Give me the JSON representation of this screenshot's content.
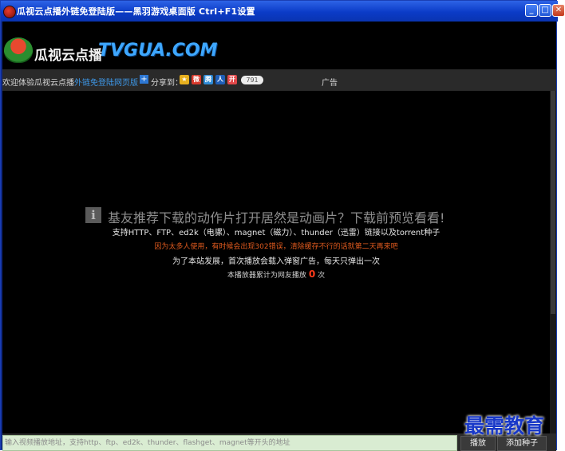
{
  "window": {
    "title": "瓜视云点播外链免登陆版——黑羽游戏桌面版 Ctrl+F1设置",
    "buttons": {
      "minimize": "_",
      "maximize": "□",
      "close": "✕"
    }
  },
  "logo": {
    "cn": "瓜视云点播",
    "en": "TVGUA.COM"
  },
  "nav": {
    "welcome": "欢迎体验瓜视云点播",
    "welcome_link": "外链免登陆网页版",
    "share_label": "分享到：",
    "share_count": "791",
    "ad_label": "广告"
  },
  "player": {
    "headline": "基友推荐下载的动作片打开居然是动画片？下载前预览看看!",
    "support": "支持HTTP、FTP、ed2k（电骡）、magnet（磁力）、thunder（迅雷）链接以及torrent种子",
    "warning": "因为太多人使用，有时候会出现302错误，清除缓存不行的话就第二天再来吧",
    "ad_notice": "为了本站发展，首次播放会载入弹窗广告，每天只弹出一次",
    "count_prefix": "本播放器累计为网友播放",
    "count_value": "0",
    "count_suffix": "次"
  },
  "bottom": {
    "url_placeholder": "输入视频播放地址，支持http、ftp、ed2k、thunder、flashget、magnet等开头的地址",
    "play_button": "播放",
    "add_seed_button": "添加种子"
  },
  "watermark": "最需教育",
  "icons": {
    "app": "watermelon-icon",
    "share": [
      "qzone-icon",
      "weibo-icon",
      "tencent-weibo-icon",
      "renren-icon",
      "kaixin-icon"
    ],
    "info": "info-icon"
  },
  "colors": {
    "titlebar": "#0b3bc7",
    "link": "#3e98e8",
    "warning": "#e05a1e",
    "count": "#ff3b1a",
    "logo_en": "#3ea7ff"
  }
}
